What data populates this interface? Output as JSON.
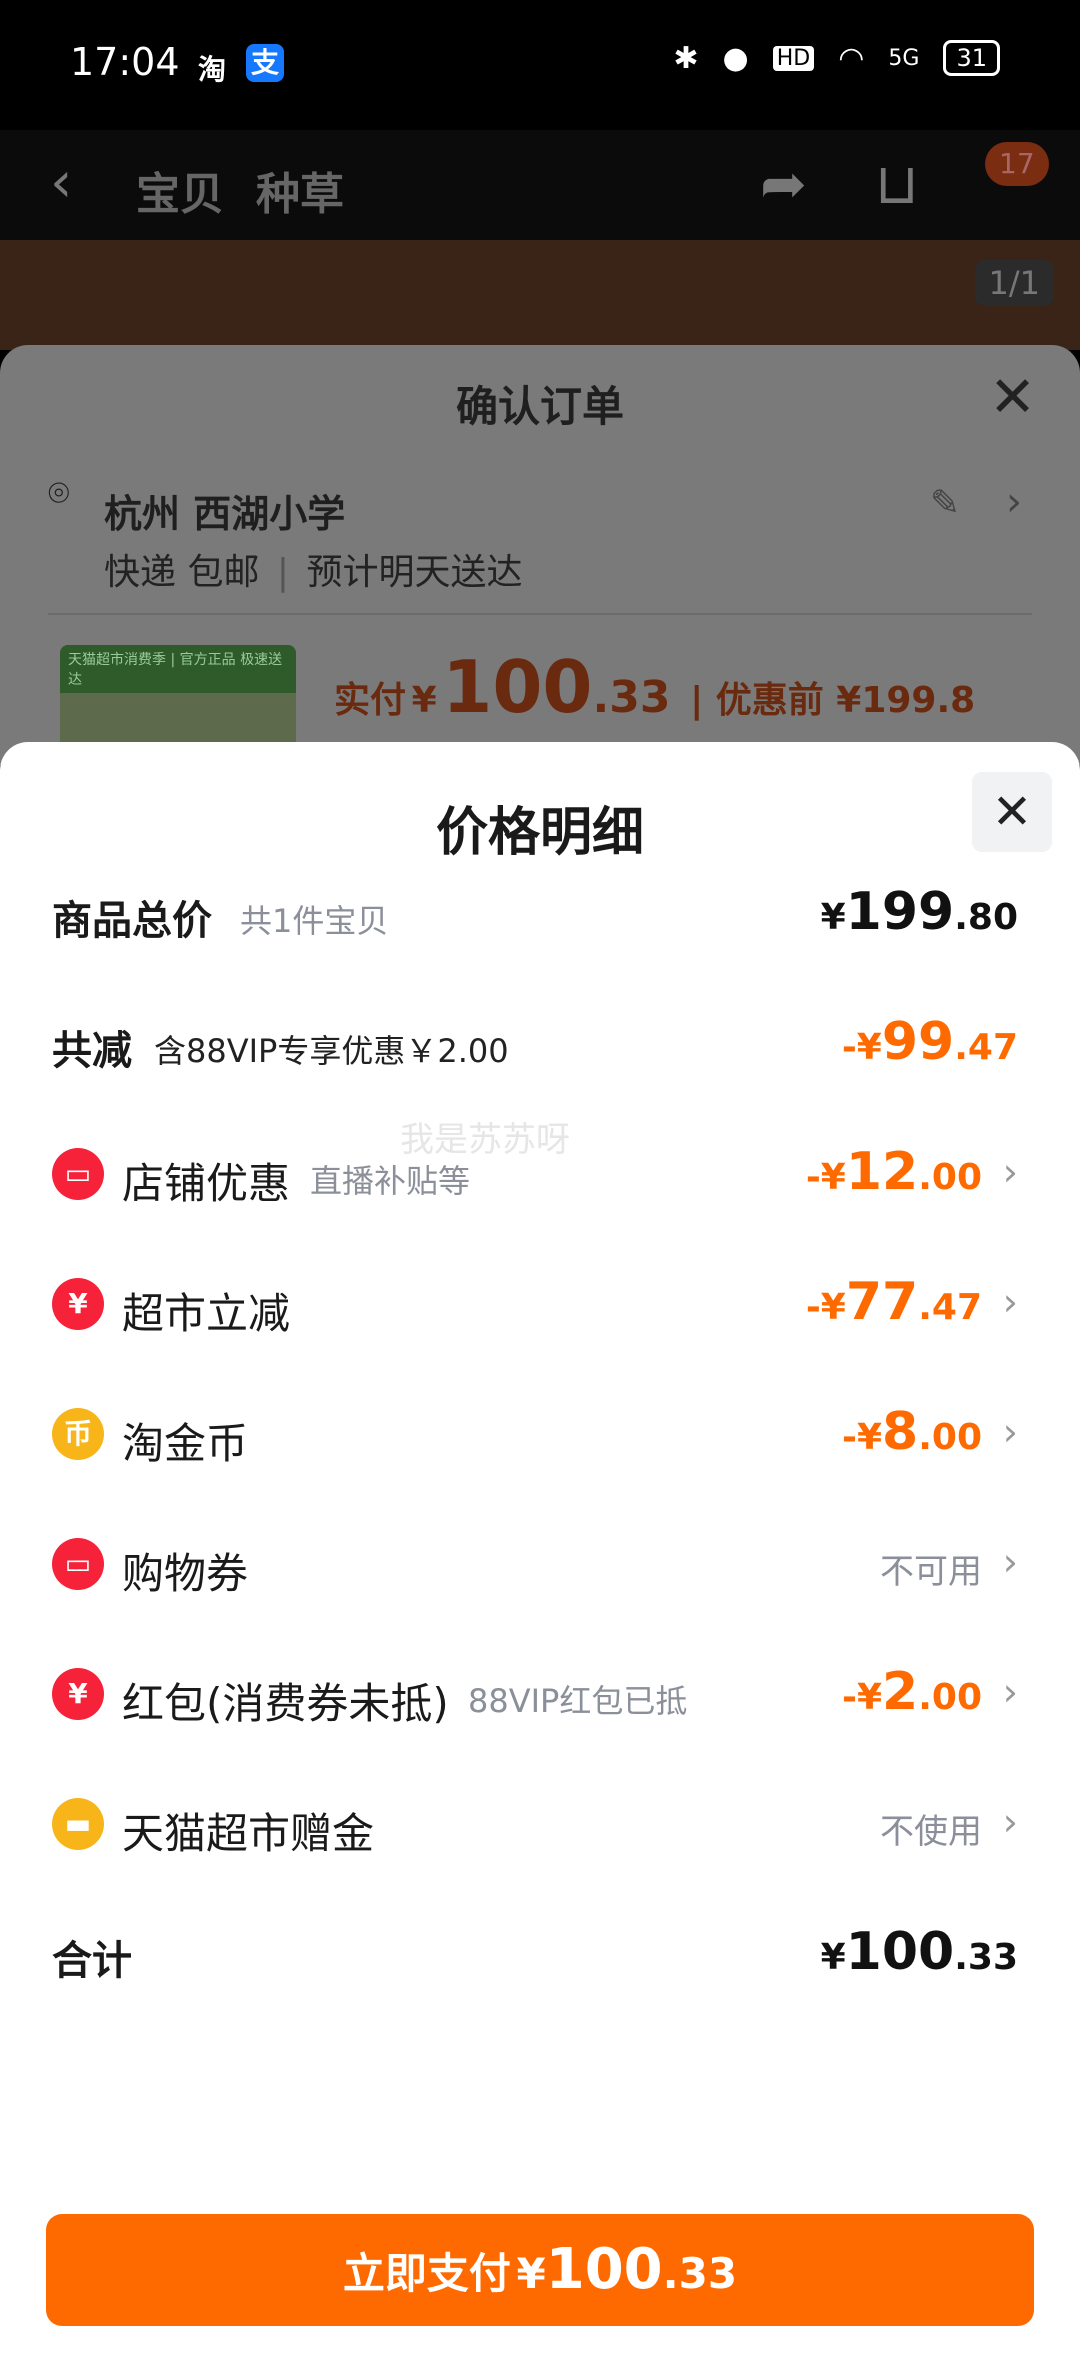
{
  "status_bar": {
    "time": "17:04",
    "app1": "淘",
    "app2": "支",
    "icons": [
      "bluetooth-icon",
      "location-icon",
      "hd-icon",
      "wifi-icon",
      "signal-icon"
    ],
    "hd": "HD",
    "signal": "5G",
    "battery": "31"
  },
  "product_nav": {
    "tab_item": "宝贝",
    "tab_seed": "种草",
    "cart_badge": "17",
    "image_page": "1/1"
  },
  "order_sheet": {
    "title": "确认订单",
    "address": "杭州 西湖小学",
    "shipping": "快递 包邮",
    "eta": "预计明天送达",
    "paid_label": "实付",
    "paid_currency": "¥",
    "paid_int": "100",
    "paid_dec": ".33",
    "pre_discount": "| 优惠前 ¥199.8",
    "thumb_strip": "天猫超市消费季 | 官方正品 极速送达"
  },
  "detail": {
    "title": "价格明细",
    "watermark": "我是苏苏呀",
    "total_goods": {
      "label": "商品总价",
      "sub": "共1件宝贝",
      "currency": "¥",
      "int": "199",
      "dec": ".80"
    },
    "total_discount": {
      "label": "共减",
      "sub": "含88VIP专享优惠￥2.00",
      "currency": "-¥",
      "int": "99",
      "dec": ".47"
    },
    "items": [
      {
        "icon": "store-coupon-icon",
        "glyph": "▭",
        "color": "#f5223a",
        "label": "店铺优惠",
        "sub": "直播补贴等",
        "currency": "-¥",
        "int": "12",
        "dec": ".00"
      },
      {
        "icon": "supermarket-discount-icon",
        "glyph": "¥",
        "color": "#f5223a",
        "label": "超市立减",
        "sub": "",
        "currency": "-¥",
        "int": "77",
        "dec": ".47"
      },
      {
        "icon": "gold-coin-icon",
        "glyph": "币",
        "color": "#f7b51a",
        "label": "淘金币",
        "sub": "",
        "currency": "-¥",
        "int": "8",
        "dec": ".00"
      },
      {
        "icon": "shopping-voucher-icon",
        "glyph": "▭",
        "color": "#f5223a",
        "label": "购物券",
        "sub": "",
        "status": "不可用"
      },
      {
        "icon": "red-packet-icon",
        "glyph": "¥",
        "color": "#f5223a",
        "label": "红包(消费券未抵)",
        "sub": "88VIP红包已抵",
        "currency": "-¥",
        "int": "2",
        "dec": ".00"
      },
      {
        "icon": "gift-money-icon",
        "glyph": "▬",
        "color": "#f7b51a",
        "label": "天猫超市赠金",
        "sub": "",
        "status": "不使用"
      }
    ],
    "sum": {
      "label": "合计",
      "currency": "¥",
      "int": "100",
      "dec": ".33"
    },
    "pay_button": {
      "label": "立即支付",
      "currency": "¥",
      "int": "100",
      "dec": ".33"
    }
  }
}
